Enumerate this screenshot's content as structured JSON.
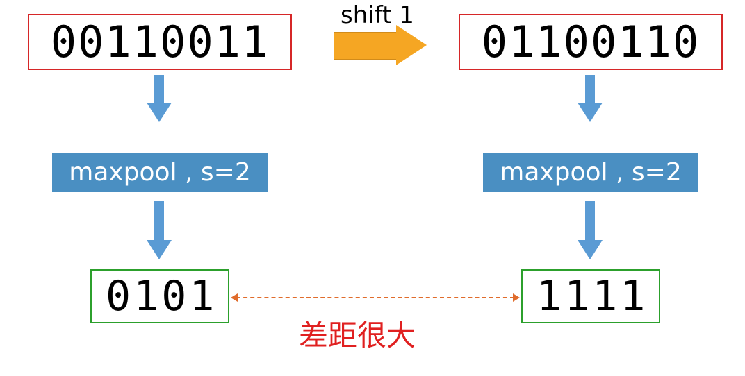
{
  "inputs": {
    "left": "00110011",
    "right": "01100110"
  },
  "shift_label": "shift 1",
  "operation": {
    "left": "maxpool , s=2",
    "right": "maxpool , s=2"
  },
  "outputs": {
    "left": "0101",
    "right": "1111"
  },
  "diff_label": "差距很大",
  "colors": {
    "input_border": "#d62728",
    "output_border": "#2ca02c",
    "op_bg": "#4a8fc2",
    "arrow_blue": "#5a9bd4",
    "arrow_orange": "#f5a623",
    "dashed_orange": "#e06c2c",
    "diff_text": "#e02020"
  }
}
